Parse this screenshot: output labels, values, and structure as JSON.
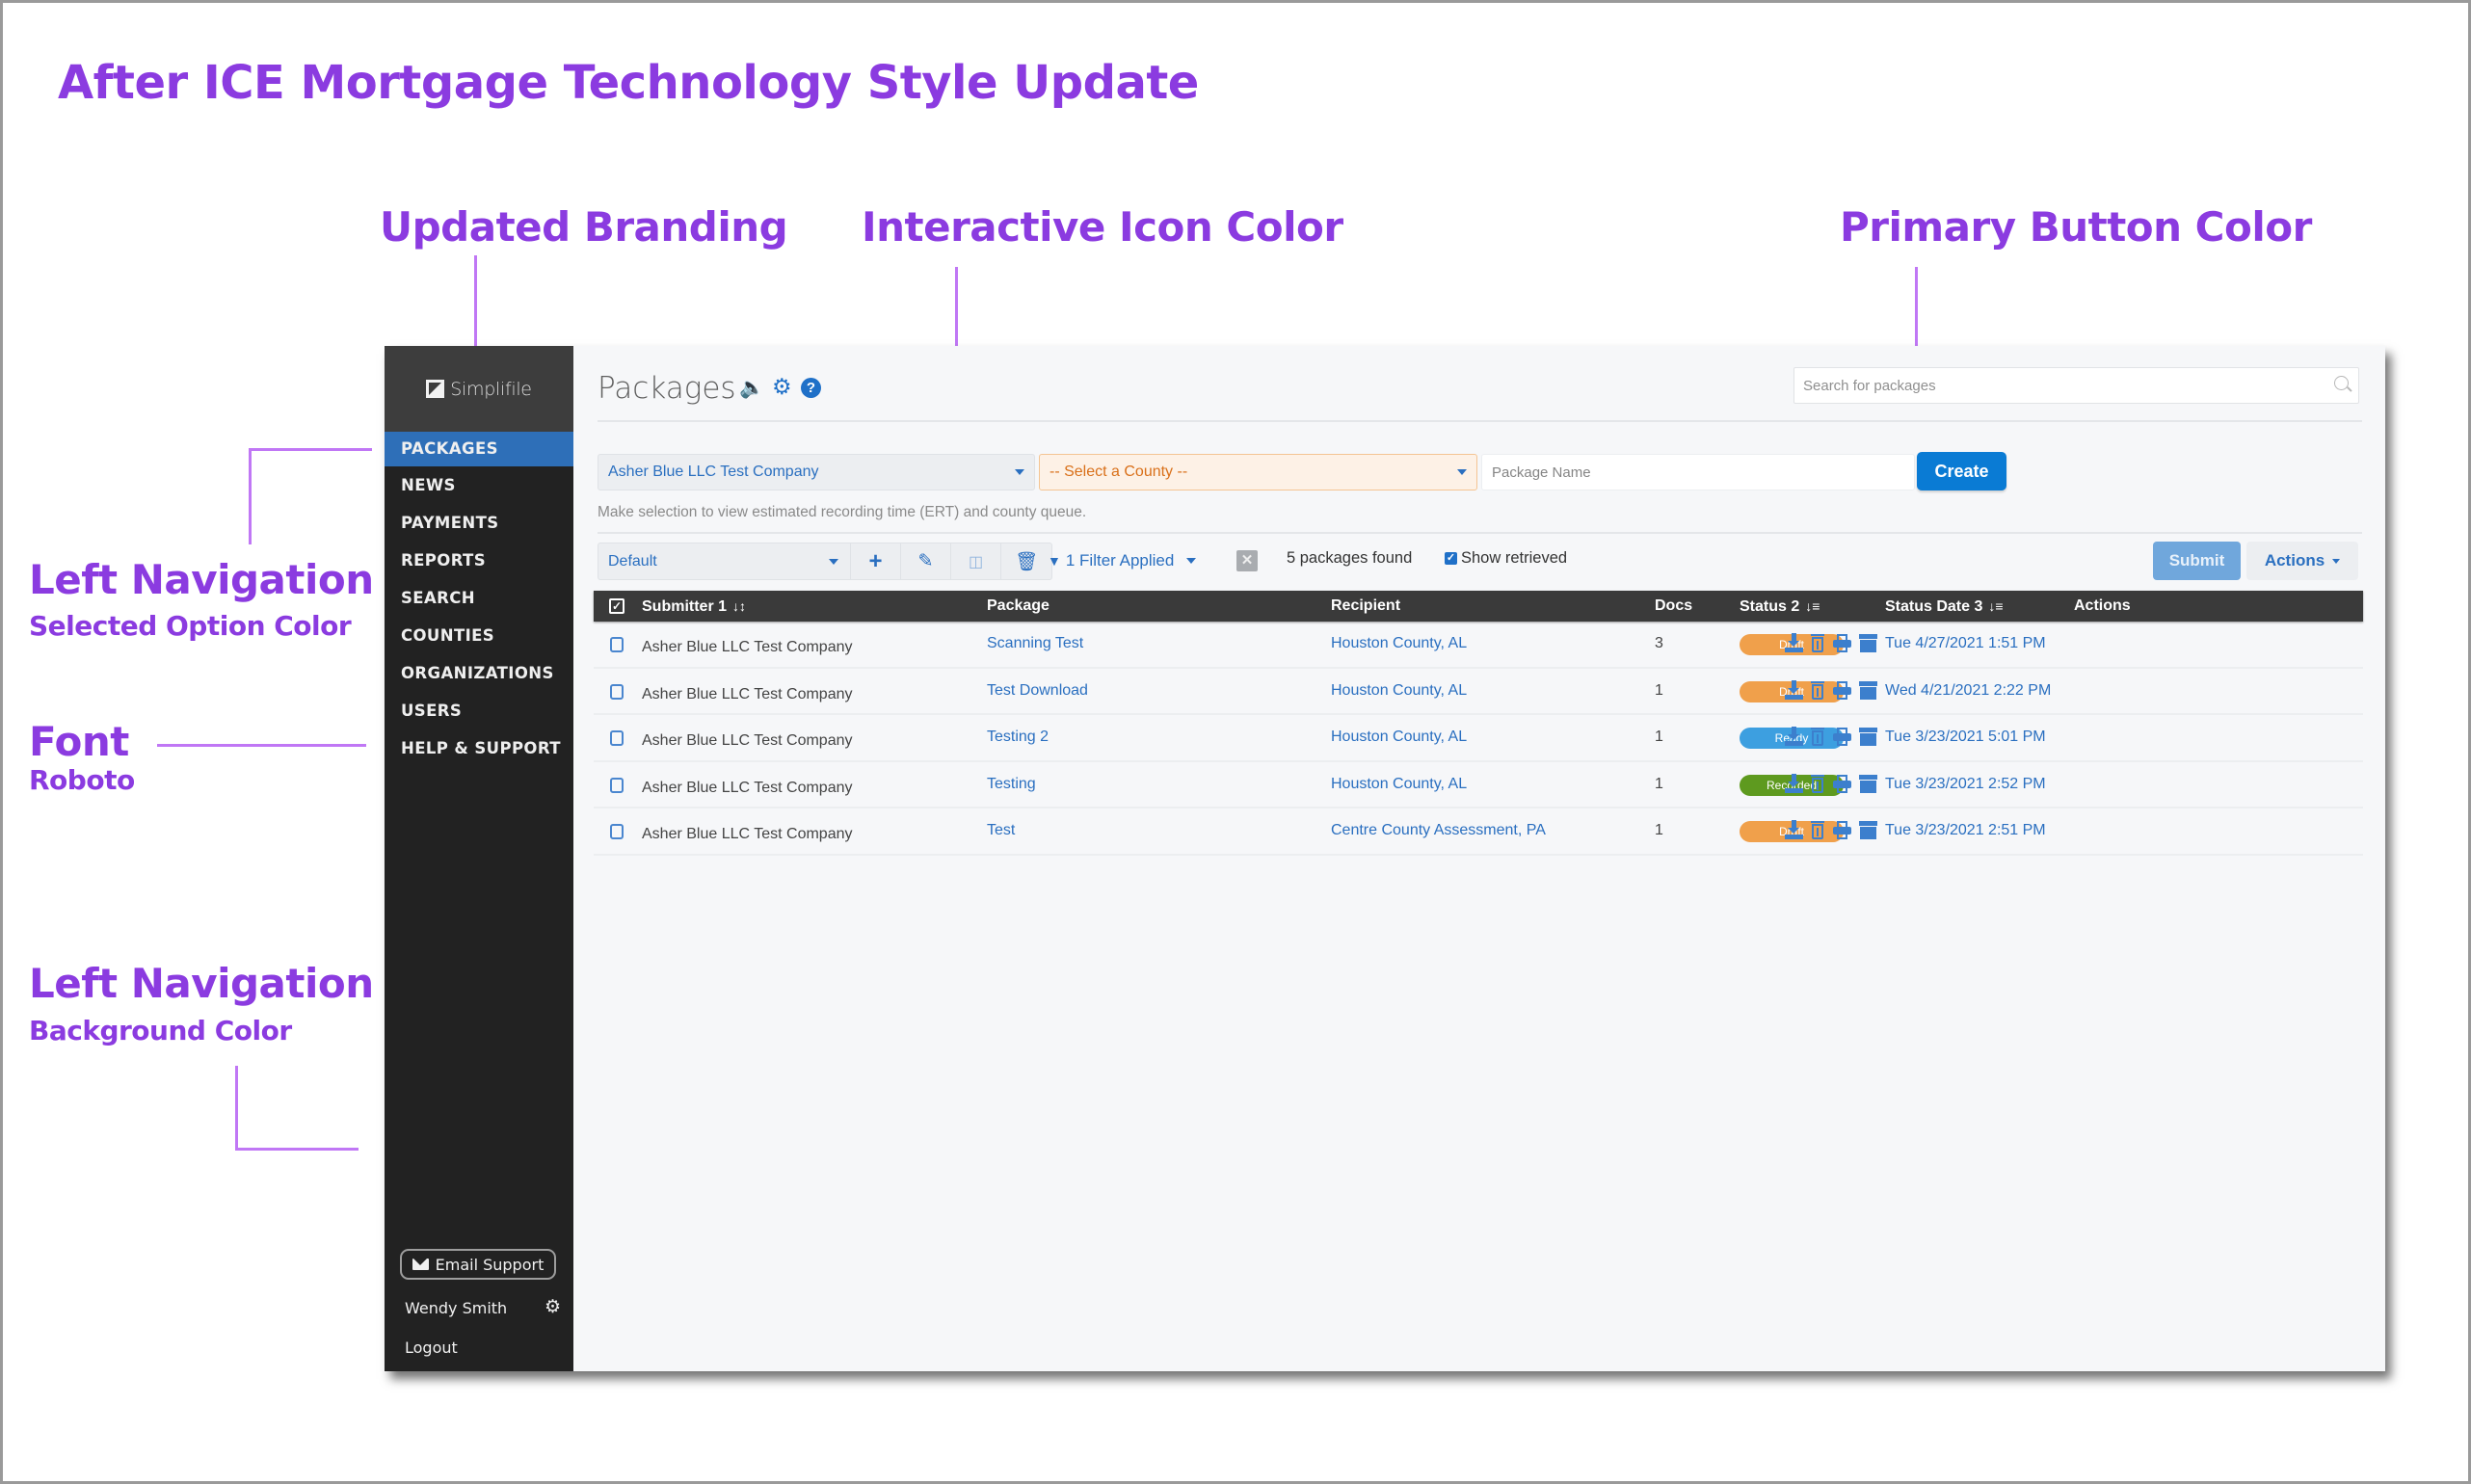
{
  "annotations": {
    "title": "After ICE Mortgage Technology Style Update",
    "updated_branding": "Updated Branding",
    "interactive_icon_color": "Interactive Icon Color",
    "primary_button_color": "Primary Button Color",
    "left_nav_selected": {
      "heading": "Left Navigation",
      "sub": "Selected Option Color"
    },
    "font_left": {
      "heading": "Font",
      "sub": "Roboto"
    },
    "left_nav_background": {
      "heading": "Left Navigation",
      "sub": "Background Color"
    },
    "font_bottom": {
      "heading": "Font",
      "sub": "Roboto"
    },
    "accent_color": "#8b3be0"
  },
  "app": {
    "brand": "Simplifile",
    "colors": {
      "sidebar_bg": "#222222",
      "nav_selected": "#2e6fb8",
      "interactive_icon": "#1f70c8",
      "primary_button": "#0a7bd4"
    },
    "sidebar": {
      "items": [
        {
          "label": "PACKAGES",
          "active": true
        },
        {
          "label": "NEWS"
        },
        {
          "label": "PAYMENTS"
        },
        {
          "label": "REPORTS"
        },
        {
          "label": "SEARCH"
        },
        {
          "label": "COUNTIES"
        },
        {
          "label": "ORGANIZATIONS"
        },
        {
          "label": "USERS"
        },
        {
          "label": "HELP & SUPPORT"
        }
      ],
      "email_support": "Email Support",
      "user_name": "Wendy Smith",
      "logout": "Logout"
    },
    "header": {
      "title": "Packages",
      "icons": [
        "volume-icon",
        "gear-icon",
        "help-icon"
      ],
      "search_placeholder": "Search for packages"
    },
    "filters": {
      "submitter_select": "Asher Blue LLC Test Company",
      "county_select": "-- Select a County --",
      "package_name_placeholder": "Package Name",
      "create_label": "Create",
      "hint": "Make selection to view estimated recording time (ERT) and county queue."
    },
    "toolbar": {
      "view_select": "Default",
      "filter_label": "1 Filter Applied",
      "packages_found": "5 packages found",
      "show_retrieved_label": "Show retrieved",
      "show_retrieved_checked": true,
      "submit_label": "Submit",
      "actions_label": "Actions"
    },
    "table": {
      "headers": {
        "submitter": "Submitter 1",
        "package": "Package",
        "recipient": "Recipient",
        "docs": "Docs",
        "status": "Status 2",
        "status_date": "Status Date 3",
        "actions": "Actions"
      },
      "rows": [
        {
          "submitter": "Asher Blue LLC Test Company",
          "package": "Scanning Test",
          "recipient": "Houston County, AL",
          "docs": "3",
          "status": "Draft",
          "status_color": "#f0a04b",
          "status_date": "Tue 4/27/2021 1:51 PM"
        },
        {
          "submitter": "Asher Blue LLC Test Company",
          "package": "Test Download",
          "recipient": "Houston County, AL",
          "docs": "1",
          "status": "Draft",
          "status_color": "#f0a04b",
          "status_date": "Wed 4/21/2021 2:22 PM"
        },
        {
          "submitter": "Asher Blue LLC Test Company",
          "package": "Testing 2",
          "recipient": "Houston County, AL",
          "docs": "1",
          "status": "Ready",
          "status_color": "#3d9fe0",
          "status_date": "Tue 3/23/2021 5:01 PM"
        },
        {
          "submitter": "Asher Blue LLC Test Company",
          "package": "Testing",
          "recipient": "Houston County, AL",
          "docs": "1",
          "status": "Recorded",
          "status_color": "#5e9a1f",
          "status_date": "Tue 3/23/2021 2:52 PM"
        },
        {
          "submitter": "Asher Blue LLC Test Company",
          "package": "Test",
          "recipient": "Centre County Assessment, PA",
          "docs": "1",
          "status": "Draft",
          "status_color": "#f0a04b",
          "status_date": "Tue 3/23/2021 2:51 PM"
        }
      ]
    }
  }
}
